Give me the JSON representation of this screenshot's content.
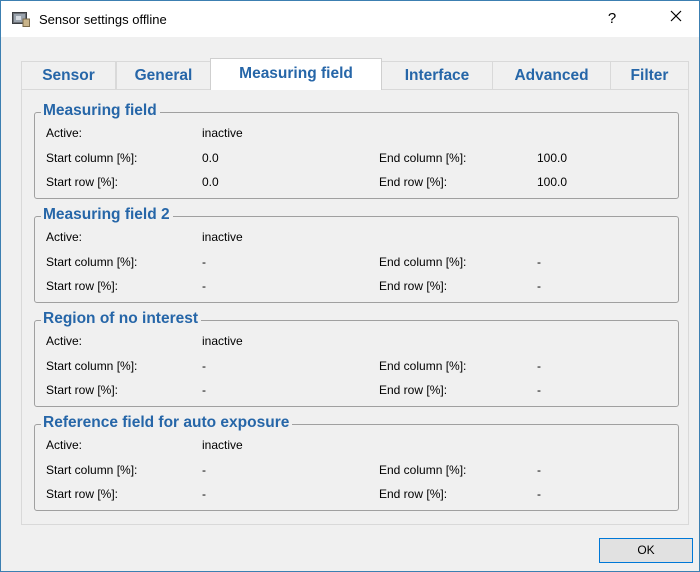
{
  "window": {
    "title": "Sensor settings offline",
    "help_label": "?",
    "ok_label": "OK"
  },
  "tabs": [
    {
      "label": "Sensor",
      "active": false
    },
    {
      "label": "General",
      "active": false
    },
    {
      "label": "Measuring field",
      "active": true
    },
    {
      "label": "Interface",
      "active": false
    },
    {
      "label": "Advanced",
      "active": false
    },
    {
      "label": "Filter",
      "active": false
    }
  ],
  "groups": [
    {
      "title": "Measuring field",
      "active_label": "Active:",
      "active_value": "inactive",
      "start_column_label": "Start column [%]:",
      "start_column_value": "0.0",
      "end_column_label": "End column [%]:",
      "end_column_value": "100.0",
      "start_row_label": "Start row [%]:",
      "start_row_value": "0.0",
      "end_row_label": "End row [%]:",
      "end_row_value": "100.0"
    },
    {
      "title": "Measuring field 2",
      "active_label": "Active:",
      "active_value": "inactive",
      "start_column_label": "Start column [%]:",
      "start_column_value": "-",
      "end_column_label": "End column [%]:",
      "end_column_value": "-",
      "start_row_label": "Start row [%]:",
      "start_row_value": "-",
      "end_row_label": "End row [%]:",
      "end_row_value": "-"
    },
    {
      "title": "Region of no interest",
      "active_label": "Active:",
      "active_value": "inactive",
      "start_column_label": "Start column [%]:",
      "start_column_value": "-",
      "end_column_label": "End column [%]:",
      "end_column_value": "-",
      "start_row_label": "Start row [%]:",
      "start_row_value": "-",
      "end_row_label": "End row [%]:",
      "end_row_value": "-"
    },
    {
      "title": "Reference field for auto exposure",
      "active_label": "Active:",
      "active_value": "inactive",
      "start_column_label": "Start column [%]:",
      "start_column_value": "-",
      "end_column_label": "End column [%]:",
      "end_column_value": "-",
      "start_row_label": "Start row [%]:",
      "start_row_value": "-",
      "end_row_label": "End row [%]:",
      "end_row_value": "-"
    }
  ],
  "colors": {
    "accent": "#2666a8",
    "window_border": "#3c7fb1",
    "ok_border": "#0078d7"
  },
  "icons": {
    "app": "sensor-app-icon",
    "close": "close-icon"
  }
}
